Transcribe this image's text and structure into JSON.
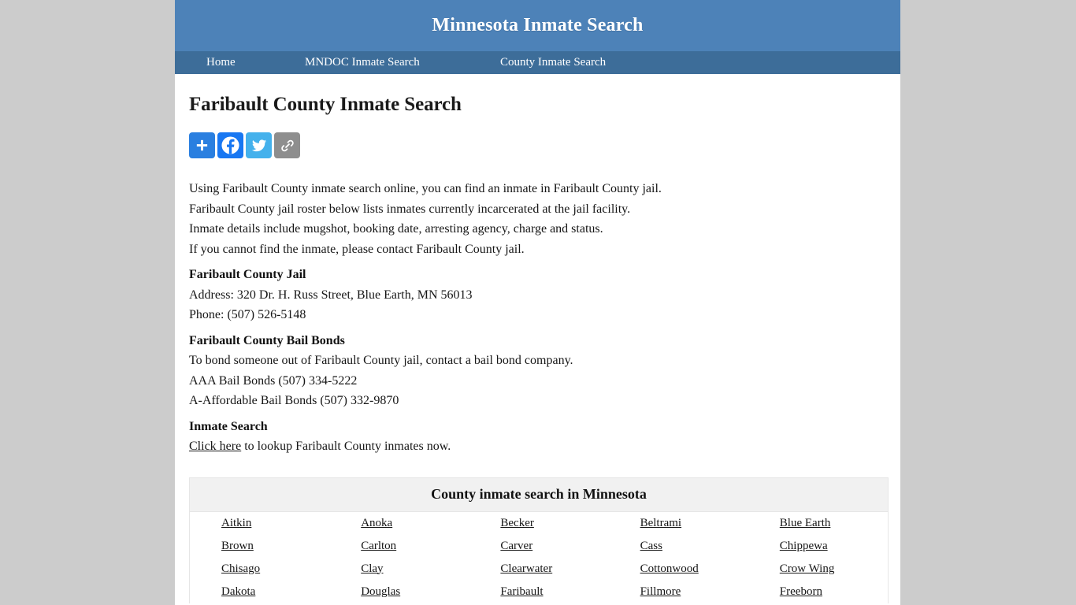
{
  "site": {
    "title": "Minnesota Inmate Search",
    "nav": [
      {
        "label": "Home",
        "name": "nav-home"
      },
      {
        "label": "MNDOC Inmate Search",
        "name": "nav-mndoc-inmate-search"
      },
      {
        "label": "County Inmate Search",
        "name": "nav-county-inmate-search"
      }
    ]
  },
  "page": {
    "title": "Faribault County Inmate Search"
  },
  "share": {
    "buttons": [
      {
        "icon": "addthis-plus-icon",
        "label": "Share"
      },
      {
        "icon": "facebook-icon",
        "label": "Facebook"
      },
      {
        "icon": "twitter-icon",
        "label": "Twitter"
      },
      {
        "icon": "copy-link-icon",
        "label": "Copy Link"
      }
    ],
    "colors": {
      "addthis": "#2a7fe0",
      "facebook": "#1877f2",
      "twitter": "#44b1ec",
      "link": "#8e8e8e"
    }
  },
  "intro": {
    "line1": "Using Faribault County inmate search online, you can find an inmate in Faribault County jail.",
    "line2": "Faribault County jail roster below lists inmates currently incarcerated at the jail facility.",
    "line3": "Inmate details include mugshot, booking date, arresting agency, charge and status.",
    "line4": "If you cannot find the inmate, please contact Faribault County jail."
  },
  "jail": {
    "heading": "Faribault County Jail",
    "address": "Address: 320 Dr. H. Russ Street, Blue Earth, MN 56013",
    "phone": "Phone: (507) 526-5148"
  },
  "bail": {
    "heading": "Faribault County Bail Bonds",
    "line1": "To bond someone out of Faribault County jail, contact a bail bond company.",
    "line2": "AAA Bail Bonds (507) 334-5222",
    "line3": "A-Affordable Bail Bonds (507) 332-9870"
  },
  "inmate_search": {
    "heading": "Inmate Search",
    "link_text": "Click here",
    "after_link": " to lookup Faribault County inmates now."
  },
  "county_table": {
    "heading": "County inmate search in Minnesota",
    "rows": [
      [
        "Aitkin",
        "Anoka",
        "Becker",
        "Beltrami",
        "Blue Earth"
      ],
      [
        "Brown",
        "Carlton",
        "Carver",
        "Cass",
        "Chippewa"
      ],
      [
        "Chisago",
        "Clay",
        "Clearwater",
        "Cottonwood",
        "Crow Wing"
      ],
      [
        "Dakota",
        "Douglas",
        "Faribault",
        "Fillmore",
        "Freeborn"
      ]
    ]
  },
  "theme": {
    "header_bg": "#4d82b8",
    "nav_bg": "#3d6d99",
    "page_bg": "#cccccc",
    "content_bg": "#ffffff",
    "table_head_bg": "#f1f1f1",
    "text": "#161616"
  }
}
